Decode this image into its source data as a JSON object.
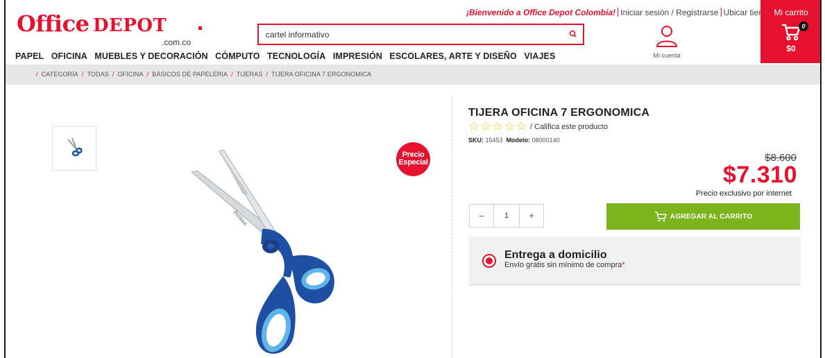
{
  "brand": {
    "logo_office": "Office",
    "logo_depot": "DEPOT",
    "logo_domain": ".com.co"
  },
  "search": {
    "value": "cartel informativo",
    "icon": "search-icon"
  },
  "topbar": {
    "welcome": "¡Bienvenido a Office Depot Colombia!",
    "login": "Iniciar sesión / Registrarse",
    "store": "Ubicar tienda"
  },
  "account": {
    "label": "Mi cuenta",
    "icon": "user-icon"
  },
  "cart": {
    "title": "Mi carrito",
    "count": "0",
    "amount": "$0",
    "icon": "cart-icon"
  },
  "nav": {
    "items": [
      "PAPEL",
      "OFICINA",
      "MUEBLES Y DECORACIÓN",
      "CÓMPUTO",
      "TECNOLOGÍA",
      "IMPRESIÓN",
      "ESCOLARES, ARTE Y DISEÑO",
      "VIAJES"
    ]
  },
  "breadcrumb": [
    "CATEGORÍA",
    "TODAS",
    "OFICINA",
    "BÁSICOS DE PAPELERIA",
    "TIJERAS",
    "TIJERA OFICINA 7 ERGONOMICA"
  ],
  "product": {
    "title": "TIJERA OFICINA 7 ERGONOMICA",
    "rating_stars": 0,
    "rate_label": "/ Califica este producto",
    "sku_label": "SKU:",
    "sku": "15453",
    "model_label": "Modelo:",
    "model": "08000140",
    "promo_line1": "Precio",
    "promo_line2": "Especial",
    "old_price": "$8.600",
    "price": "$7.310",
    "price_note": "Precio exclusivo por internet",
    "qty": "1",
    "qty_minus": "–",
    "qty_plus": "+",
    "add_to_cart": "AGREGAR AL CARRITO"
  },
  "delivery": {
    "title": "Entrega a domicilio",
    "subtitle": "Envío gratis sin mínimo de compra",
    "asterisk": "*"
  },
  "colors": {
    "brand_red": "#e5112e",
    "cta_green": "#7ab51d",
    "star_yellow": "#f0c419",
    "scissor_blue": "#1f4fa3",
    "scissor_light_blue": "#5fb4e8"
  }
}
